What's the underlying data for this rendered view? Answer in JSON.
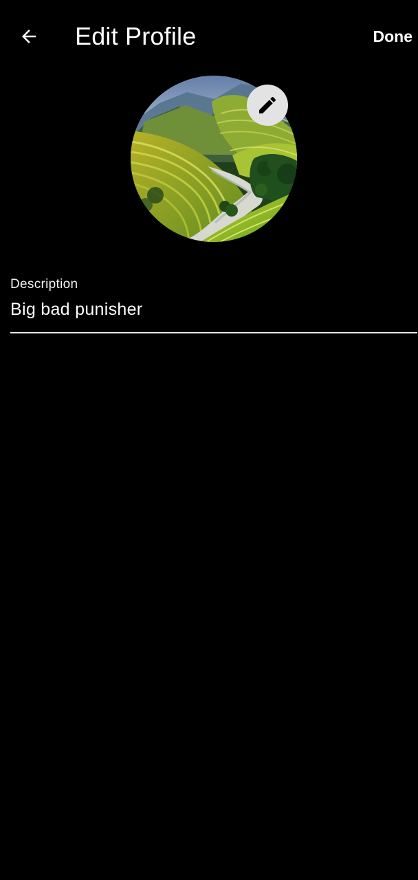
{
  "header": {
    "title": "Edit Profile",
    "done_label": "Done",
    "back_icon": "arrow-left-icon"
  },
  "avatar": {
    "image_subject": "terraced rice fields landscape",
    "edit_icon": "pencil-icon"
  },
  "description_field": {
    "label": "Description",
    "value": "Big bad punisher"
  },
  "colors": {
    "background": "#000000",
    "text": "#ffffff",
    "edit_button_bg": "#e3e3e3",
    "underline": "#e9e9e9"
  }
}
